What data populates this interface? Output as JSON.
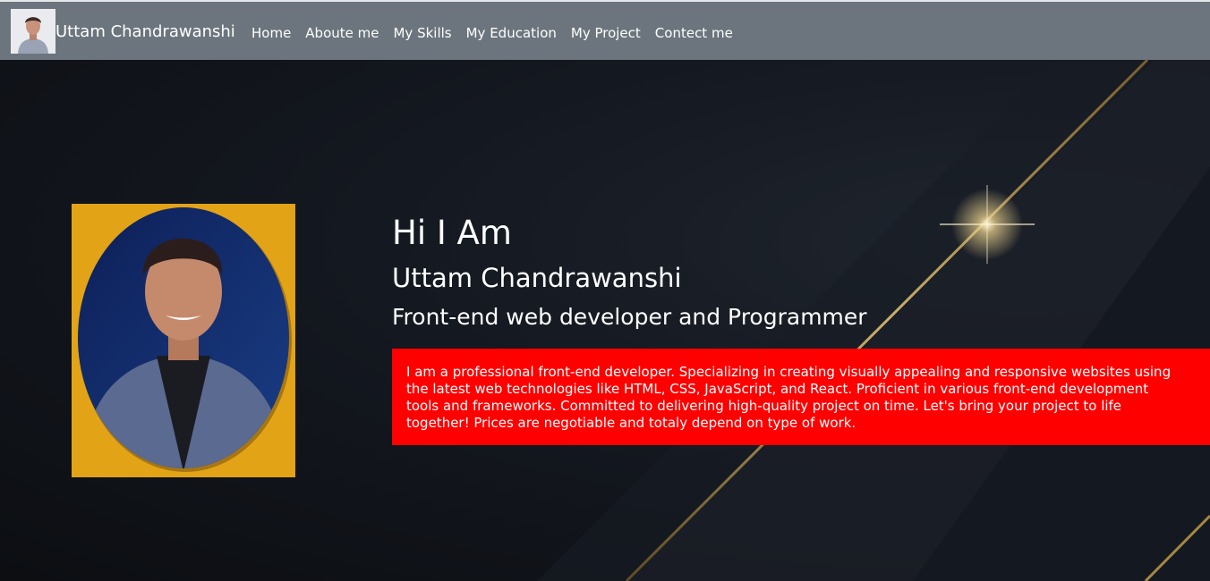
{
  "navbar": {
    "brand_name": "Uttam Chandrawanshi",
    "links": [
      "Home",
      "Aboute me",
      "My Skills",
      "My Education",
      "My Project",
      "Contect me"
    ]
  },
  "hero": {
    "greeting": "Hi I Am",
    "name": "Uttam Chandrawanshi",
    "role": "Front-end web developer and Programmer",
    "about": "I am a professional front-end developer. Specializing in creating visually appealing and responsive websites using the latest web technologies like HTML, CSS, JavaScript, and React. Proficient in various front-end development tools and frameworks. Committed to delivering high-quality project on time. Let's bring your project to life together! Prices are negotiable and totaly depend on type of work."
  },
  "colors": {
    "navbar": "#6c757d",
    "about_box": "#ff0000",
    "photo_frame": "#e2a317",
    "gold_accent": "#c9a54a"
  }
}
